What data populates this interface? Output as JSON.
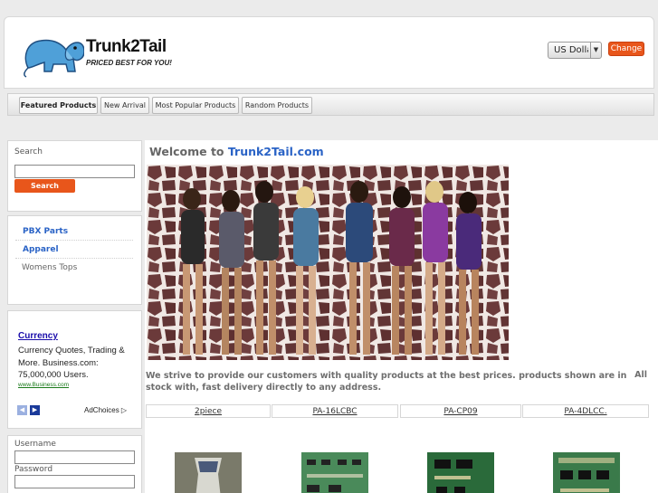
{
  "brand": {
    "name": "Trunk2Tail",
    "tagline": "PRICED BEST FOR YOU!"
  },
  "currency": {
    "selected": "US Dollar",
    "change_label": "Change"
  },
  "tabs": [
    {
      "label": "Featured Products",
      "active": true
    },
    {
      "label": "New Arrival",
      "active": false
    },
    {
      "label": "Most Popular Products",
      "active": false
    },
    {
      "label": "Random Products",
      "active": false
    }
  ],
  "search": {
    "label": "Search",
    "button": "Search"
  },
  "categories": [
    {
      "label": "PBX Parts"
    },
    {
      "label": "Apparel"
    },
    {
      "label": "Womens Tops"
    }
  ],
  "ad": {
    "title": "Currency",
    "text": "Currency Quotes, Trading & More. Business.com: 75,000,000 Users.",
    "url": "www.Business.com",
    "adchoices": "AdChoices"
  },
  "login": {
    "username_label": "Username",
    "password_label": "Password"
  },
  "main": {
    "welcome_prefix": "Welcome to ",
    "welcome_brand": "Trunk2Tail.com",
    "intro": "We strive to provide our customers with quality products at the best prices. products shown are in stock with, fast delivery directly to any address.",
    "intro_all": "All"
  },
  "products": [
    {
      "label": "2piece"
    },
    {
      "label": "PA-16LCBC"
    },
    {
      "label": "PA-CP09"
    },
    {
      "label": "PA-4DLCC."
    }
  ],
  "colors": {
    "accent_orange": "#e8561b",
    "link_blue": "#2a63c6",
    "elephant_blue": "#4fa0d8"
  }
}
